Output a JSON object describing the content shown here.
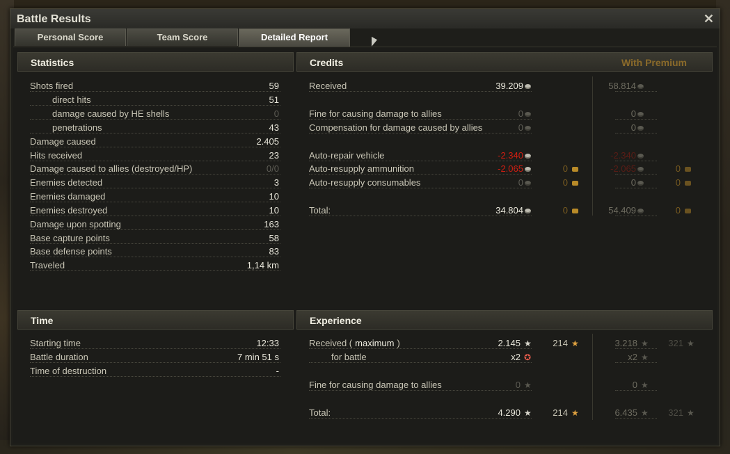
{
  "window": {
    "title": "Battle Results",
    "close": "✕"
  },
  "tabs": [
    "Personal Score",
    "Team Score",
    "Detailed Report"
  ],
  "statistics": {
    "header": "Statistics",
    "rows": [
      {
        "label": "Shots fired",
        "value": "59"
      },
      {
        "label": "direct hits",
        "value": "51"
      },
      {
        "label": "damage caused by HE shells",
        "value": "0"
      },
      {
        "label": "penetrations",
        "value": "43"
      },
      {
        "label": "Damage caused",
        "value": "2.405"
      },
      {
        "label": "Hits received",
        "value": "23"
      },
      {
        "label": "Damage caused to allies (destroyed/HP)",
        "value": "0/0"
      },
      {
        "label": "Enemies detected",
        "value": "3"
      },
      {
        "label": "Enemies damaged",
        "value": "10"
      },
      {
        "label": "Enemies destroyed",
        "value": "10"
      },
      {
        "label": "Damage upon spotting",
        "value": "163"
      },
      {
        "label": "Base capture points",
        "value": "58"
      },
      {
        "label": "Base defense points",
        "value": "83"
      },
      {
        "label": "Traveled",
        "value": "1,14 km"
      }
    ]
  },
  "time": {
    "header": "Time",
    "rows": [
      {
        "label": "Starting time",
        "value": "12:33"
      },
      {
        "label": "Battle duration",
        "value": "7 min 51 s"
      },
      {
        "label": "Time of destruction",
        "value": "-"
      }
    ]
  },
  "credits": {
    "header": "Credits",
    "premium_header": "With Premium",
    "rows": [
      {
        "label": "Received",
        "c": "39.209",
        "g": "",
        "pc": "58.814",
        "pg": ""
      },
      {
        "label": "Fine for causing damage to allies",
        "c": "0",
        "g": "",
        "pc": "0",
        "pg": ""
      },
      {
        "label": "Compensation for damage caused by allies",
        "c": "0",
        "g": "",
        "pc": "0",
        "pg": ""
      },
      {
        "label": "Auto-repair vehicle",
        "c": "-2.340",
        "g": "",
        "pc": "-2.340",
        "pg": ""
      },
      {
        "label": "Auto-resupply ammunition",
        "c": "-2.065",
        "g": "0",
        "pc": "-2.065",
        "pg": "0"
      },
      {
        "label": "Auto-resupply consumables",
        "c": "0",
        "g": "0",
        "pc": "0",
        "pg": "0"
      },
      {
        "label": "Total:",
        "c": "34.804",
        "g": "0",
        "pc": "54.409",
        "pg": "0"
      }
    ]
  },
  "experience": {
    "header": "Experience",
    "received_label": "Received (",
    "received_max": "maximum",
    "received_close": ")",
    "rows": [
      {
        "label": "Received",
        "x": "2.145",
        "fx": "214",
        "px": "3.218",
        "pfx": "321"
      },
      {
        "label": "for battle",
        "x": "x2",
        "fx": "",
        "px": "x2",
        "pfx": ""
      },
      {
        "label": "Fine for causing damage to allies",
        "x": "0",
        "fx": "",
        "px": "0",
        "pfx": ""
      },
      {
        "label": "Total:",
        "x": "4.290",
        "fx": "214",
        "px": "6.435",
        "pfx": "321"
      }
    ]
  },
  "colors": {
    "accent_gold": "#8a6a2a",
    "negative": "#d21e12"
  }
}
